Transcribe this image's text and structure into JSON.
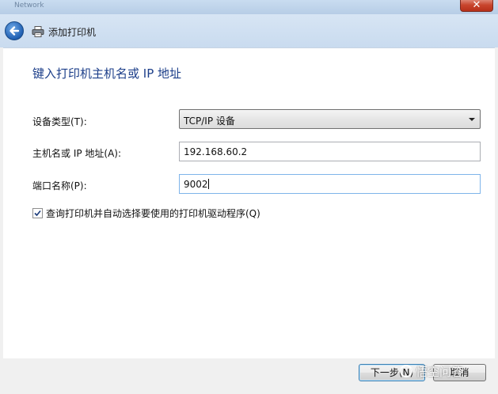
{
  "window": {
    "title": "Network",
    "close_glyph": "✕"
  },
  "nav": {
    "title": "添加打印机"
  },
  "main": {
    "heading": "键入打印机主机名或 IP 地址",
    "device_type_label": "设备类型(T):",
    "device_type_value": "TCP/IP 设备",
    "host_label": "主机名或 IP 地址(A):",
    "host_value": "192.168.60.2",
    "port_label": "端口名称(P):",
    "port_value": "9002",
    "auto_driver_label": "查询打印机并自动选择要使用的打印机驱动程序(Q)",
    "auto_driver_checked": true
  },
  "footer": {
    "next_label": "下一步(N)",
    "cancel_label": "取消",
    "watermark_text": "悟空问答"
  },
  "icons": {
    "back": "back-arrow-icon",
    "printer": "printer-icon",
    "dropdown": "chevron-down-icon",
    "check": "checkmark-icon"
  },
  "colors": {
    "heading": "#1d3f8a",
    "navbar": "#c9dbef",
    "close": "#c8452d",
    "back_button": "#1f5fb2"
  }
}
